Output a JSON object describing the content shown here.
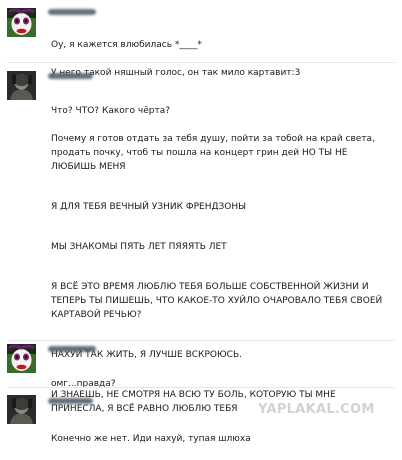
{
  "chat": {
    "messages": [
      {
        "sender": "girl",
        "avatar_icon": "clown-face-icon",
        "lines": [
          "Оу, я кажется влюбилась *____*",
          "У него такой няшный голос, он так мило картавит:3"
        ]
      },
      {
        "sender": "guy",
        "avatar_icon": "dark-figure-icon",
        "paragraphs": [
          "Что? ЧТО? Какого чёрта?",
          "Почему я готов отдать за тебя душу, пойти за тобой на край света, продать почку, чтоб ты пошла на концерт грин дей НО ТЫ НЕ ЛЮБИШЬ МЕНЯ",
          "Я ДЛЯ ТЕБЯ ВЕЧНЫЙ УЗНИК ФРЕНДЗОНЫ",
          "МЫ ЗНАКОМЫ ПЯТЬ ЛЕТ ПЯЯЯТЬ ЛЕТ",
          "Я ВСЁ ЭТО ВРЕМЯ ЛЮБЛЮ ТЕБЯ БОЛЬШЕ СОБСТВЕННОЙ ЖИЗНИ И ТЕПЕРЬ ТЫ ПИШЕШЬ, ЧТО КАКОЕ-ТО ХУЙЛО ОЧАРОВАЛО ТЕБЯ СВОЕЙ КАРТАВОЙ РЕЧЬЮ?",
          "НАХУЙ ТАК ЖИТЬ, Я ЛУЧШЕ ВСКРОЮСЬ.",
          "И ЗНАЕШЬ, НЕ СМОТРЯ НА ВСЮ ТУ БОЛЬ, КОТОРУЮ ТЫ МНЕ ПРИНЕСЛА, Я ВСЁ РАВНО ЛЮБЛЮ ТЕБЯ"
        ]
      },
      {
        "sender": "girl",
        "avatar_icon": "clown-face-icon",
        "lines": [
          "омг...правда?"
        ]
      },
      {
        "sender": "guy",
        "avatar_icon": "dark-figure-icon",
        "lines": [
          "Конечно же нет. Иди нахуй, тупая шлюха"
        ]
      }
    ]
  },
  "watermark": {
    "text": "YAPLAKAL.COM"
  },
  "colors": {
    "background": "#ffffff",
    "text": "#1a1a1a",
    "blurred_name": "#4a5566",
    "watermark": "#cfd3d7"
  }
}
